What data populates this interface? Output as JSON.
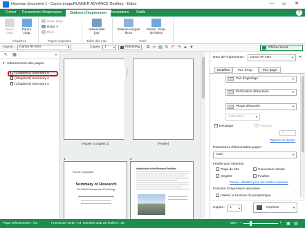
{
  "window": {
    "title": "Nouveau document 1 - Canon imageRUNNER ADVANCE Desktop - Editor",
    "minimize": "—",
    "maximize": "▭",
    "close": "✕"
  },
  "ribbon_tabs": [
    "Fichier",
    "Paramètres d'impression",
    "Options d'impression",
    "Annotations",
    "Outils"
  ],
  "help_icon": "?",
  "ribbon": {
    "chapitres": {
      "label": "Chapitres",
      "nouv_chap": "Nouv. chap.",
      "param_chap": "Param. chap."
    },
    "pages": {
      "label": "Pages originales",
      "nouv_page": "Nouv. page",
      "rotat": "Rotat.",
      "divis": "Divis."
    },
    "table": {
      "label": "Table des mat.",
      "inserer": "Insérer/Mé/ jour"
    },
    "outil": {
      "label": "Outil",
      "reduire": "Réduire marges blocs",
      "param_fusion": "Param. d'imp. de fusion"
    }
  },
  "toolbar": {
    "imprim_label": "Imprim. :",
    "printer": "Canon iR-ADV",
    "copies_label": "Copies :",
    "copies": "1",
    "print_btn": "Imprimer",
    "afficher": "Afficher annot."
  },
  "tree": {
    "root": "Arborescence des pages",
    "chapters": [
      "(Chapitre1) Summary o",
      "(Chapitre2) Summary o",
      "(Chapitre3) Summary o"
    ]
  },
  "pages": {
    "captions": [
      "(Papier à onglets 1)",
      "(Feuille)"
    ],
    "page_numbers": [
      "1",
      "2"
    ],
    "doc": {
      "org": "Pan UK Corporation",
      "heading": "Summary of Research",
      "subheading": "The Global Development of Technology",
      "body_title": "Introduction of the Research Facilities"
    }
  },
  "settings": {
    "printer_label": "Nom de l'imprimante :",
    "printer_value": "Canon iR-ADV",
    "tabs": [
      "Modèles",
      "Par. d'imp.",
      "Par. page"
    ],
    "pas_agrafage": "Pas d'agrafage",
    "perforation": "Perforation désactivée",
    "pliage": "Pliage désactivé",
    "assembler": "Assembler",
    "decalage": "Décalage",
    "rotation": "Rotation",
    "decalage_val": "1",
    "options_finition": "Options de finition",
    "alim_label": "Paramètres d'alimentation papier",
    "alim_value": "Auto",
    "feuille_label": "Feuille pour insertion",
    "page_titre": "Page de titre",
    "couv_arriere": "Couverture arrière",
    "onglets": "Onglets",
    "feuilles": "Feuilles",
    "param_detail": "Param. détaillés pour les feuilles insérées",
    "fonction_label": "Fonction d'impression sécurisée",
    "utiliser": "Utiliser la fonction du périphérique",
    "copies_label": "Copies :",
    "copies": "1",
    "print_btn": "Imprimer"
  },
  "status": {
    "pages_sel": "Page sélectionnée : /33",
    "format": "Format de sortie :A4",
    "total": "Nombre total de feuilles : 39",
    "zoom": "25%"
  },
  "colors": {
    "accent": "#1c8d4d",
    "highlight": "#e00000"
  }
}
